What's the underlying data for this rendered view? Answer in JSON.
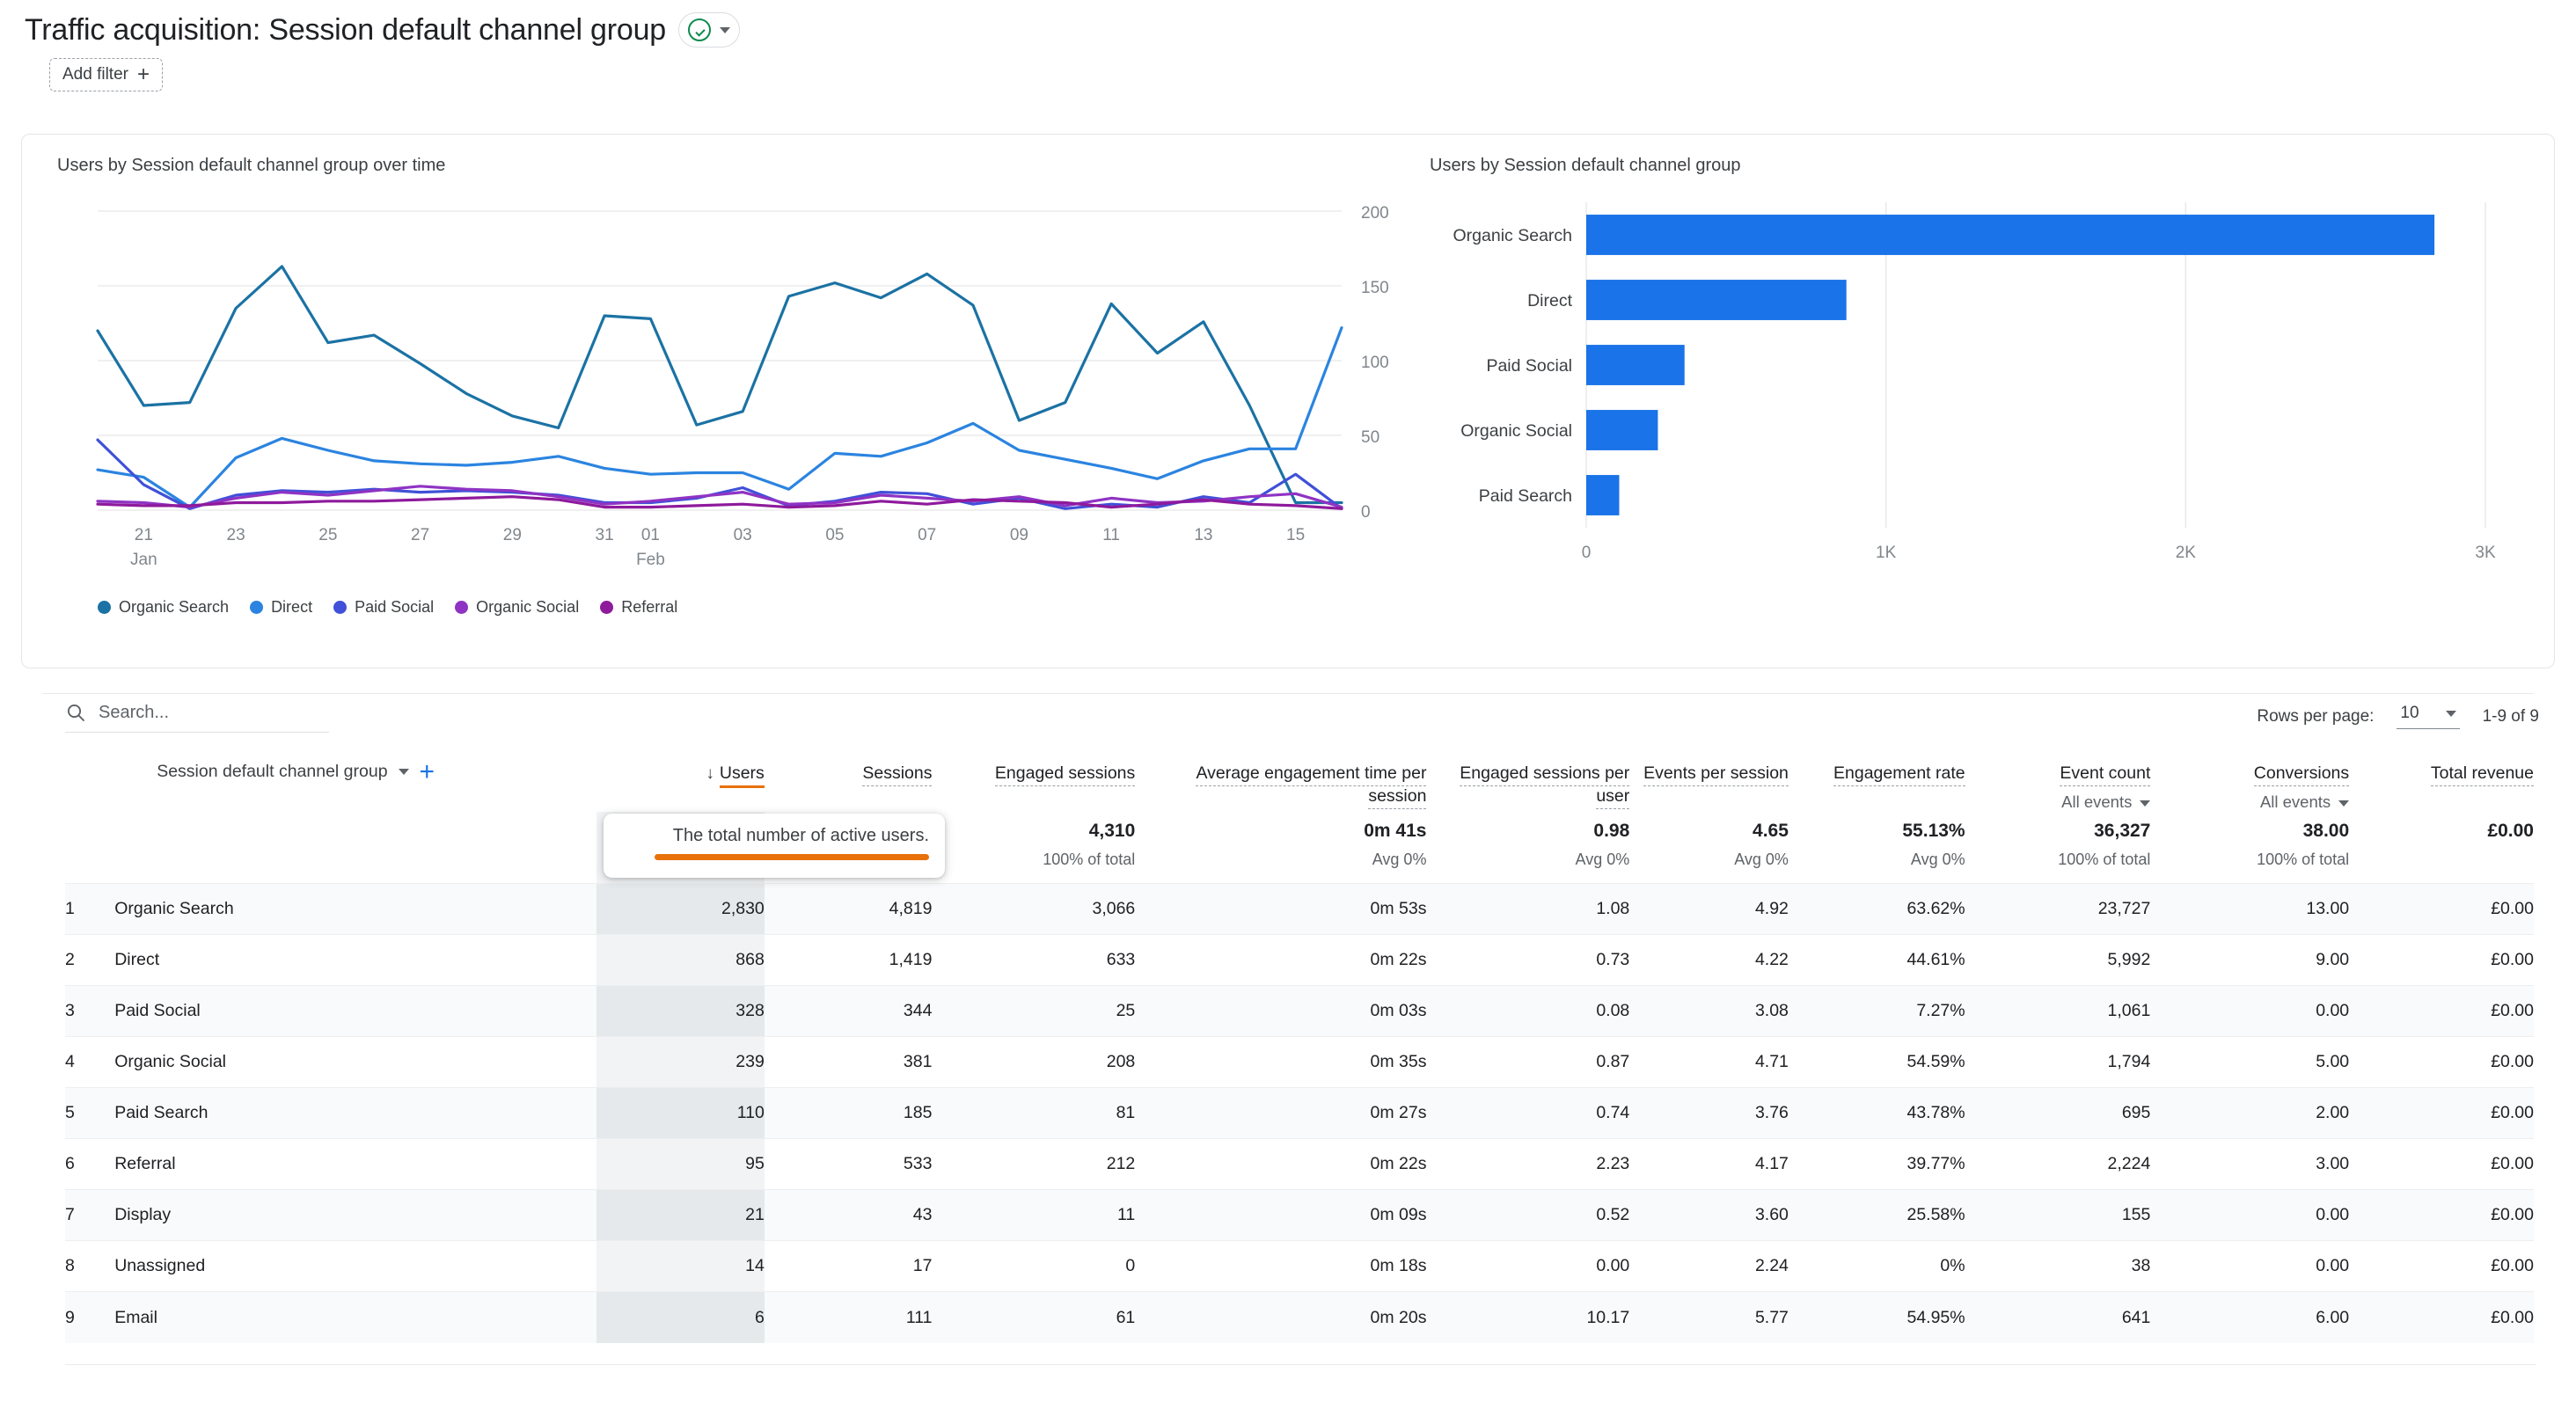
{
  "header": {
    "title": "Traffic acquisition: Session default channel group",
    "ai_icon": "check-circle-icon",
    "caret_icon": "chevron-down-icon",
    "add_filter_label": "Add filter",
    "add_filter_icon": "plus-icon"
  },
  "line_card": {
    "title": "Users by Session default channel group over time"
  },
  "bar_card": {
    "title": "Users by Session default channel group"
  },
  "toolbar": {
    "search_placeholder": "Search...",
    "search_icon": "search-icon",
    "rows_per_page_label": "Rows per page:",
    "rows_per_page_value": "10",
    "range_label": "1-9 of 9"
  },
  "tooltip": {
    "text": "The total number of active users.",
    "accent": "#e8710a"
  },
  "table": {
    "dimension_label": "Session default channel group",
    "add_dimension_icon": "plus-icon",
    "sort_icon": "arrow-down-icon",
    "columns": [
      {
        "label": "Users",
        "sorted": true
      },
      {
        "label": "Sessions"
      },
      {
        "label": "Engaged sessions"
      },
      {
        "label": "Average engagement time per session"
      },
      {
        "label": "Engaged sessions per user"
      },
      {
        "label": "Events per session"
      },
      {
        "label": "Engagement rate"
      },
      {
        "label": "Event count",
        "sub": "All events"
      },
      {
        "label": "Conversions",
        "sub": "All events"
      },
      {
        "label": "Total revenue"
      }
    ],
    "totals": [
      {
        "value": "",
        "sub": "100% of total"
      },
      {
        "value": "",
        "sub": "100% of total"
      },
      {
        "value": "4,310",
        "sub": "100% of total"
      },
      {
        "value": "0m 41s",
        "sub": "Avg 0%"
      },
      {
        "value": "0.98",
        "sub": "Avg 0%"
      },
      {
        "value": "4.65",
        "sub": "Avg 0%"
      },
      {
        "value": "55.13%",
        "sub": "Avg 0%"
      },
      {
        "value": "36,327",
        "sub": "100% of total"
      },
      {
        "value": "38.00",
        "sub": "100% of total"
      },
      {
        "value": "£0.00",
        "sub": ""
      }
    ],
    "rows": [
      {
        "index": "1",
        "name": "Organic Search",
        "cells": [
          "2,830",
          "4,819",
          "3,066",
          "0m 53s",
          "1.08",
          "4.92",
          "63.62%",
          "23,727",
          "13.00",
          "£0.00"
        ]
      },
      {
        "index": "2",
        "name": "Direct",
        "cells": [
          "868",
          "1,419",
          "633",
          "0m 22s",
          "0.73",
          "4.22",
          "44.61%",
          "5,992",
          "9.00",
          "£0.00"
        ]
      },
      {
        "index": "3",
        "name": "Paid Social",
        "cells": [
          "328",
          "344",
          "25",
          "0m 03s",
          "0.08",
          "3.08",
          "7.27%",
          "1,061",
          "0.00",
          "£0.00"
        ]
      },
      {
        "index": "4",
        "name": "Organic Social",
        "cells": [
          "239",
          "381",
          "208",
          "0m 35s",
          "0.87",
          "4.71",
          "54.59%",
          "1,794",
          "5.00",
          "£0.00"
        ]
      },
      {
        "index": "5",
        "name": "Paid Search",
        "cells": [
          "110",
          "185",
          "81",
          "0m 27s",
          "0.74",
          "3.76",
          "43.78%",
          "695",
          "2.00",
          "£0.00"
        ]
      },
      {
        "index": "6",
        "name": "Referral",
        "cells": [
          "95",
          "533",
          "212",
          "0m 22s",
          "2.23",
          "4.17",
          "39.77%",
          "2,224",
          "3.00",
          "£0.00"
        ]
      },
      {
        "index": "7",
        "name": "Display",
        "cells": [
          "21",
          "43",
          "11",
          "0m 09s",
          "0.52",
          "3.60",
          "25.58%",
          "155",
          "0.00",
          "£0.00"
        ]
      },
      {
        "index": "8",
        "name": "Unassigned",
        "cells": [
          "14",
          "17",
          "0",
          "0m 18s",
          "0.00",
          "2.24",
          "0%",
          "38",
          "0.00",
          "£0.00"
        ]
      },
      {
        "index": "9",
        "name": "Email",
        "cells": [
          "6",
          "111",
          "61",
          "0m 20s",
          "10.17",
          "5.77",
          "54.95%",
          "641",
          "6.00",
          "£0.00"
        ]
      }
    ]
  },
  "chart_data": [
    {
      "type": "line",
      "title": "Users by Session default channel group over time",
      "xlabel": "",
      "ylabel": "",
      "ylim": [
        0,
        200
      ],
      "yticks": [
        0,
        50,
        100,
        150,
        200
      ],
      "grid": true,
      "legend_position": "bottom",
      "x": [
        "20",
        "21",
        "22",
        "23",
        "24",
        "25",
        "26",
        "27",
        "28",
        "29",
        "30",
        "31",
        "01",
        "02",
        "03",
        "04",
        "05",
        "06",
        "07",
        "08",
        "09",
        "10",
        "11",
        "12",
        "13",
        "14",
        "15",
        "16"
      ],
      "xticks": [
        "21",
        "23",
        "25",
        "27",
        "29",
        "31",
        "01",
        "03",
        "05",
        "07",
        "09",
        "11",
        "13",
        "15"
      ],
      "xtick_sublabels": {
        "21": "Jan",
        "01": "Feb"
      },
      "series": [
        {
          "name": "Organic Search",
          "color": "#1b72a4",
          "values": [
            120,
            70,
            72,
            135,
            163,
            112,
            117,
            98,
            78,
            63,
            55,
            130,
            128,
            57,
            66,
            143,
            152,
            142,
            158,
            137,
            60,
            72,
            138,
            105,
            126,
            70,
            5,
            5
          ]
        },
        {
          "name": "Direct",
          "color": "#2b84e0",
          "values": [
            27,
            22,
            2,
            35,
            48,
            40,
            33,
            31,
            30,
            32,
            36,
            28,
            24,
            25,
            25,
            14,
            38,
            36,
            45,
            58,
            40,
            34,
            28,
            21,
            33,
            41,
            41,
            122
          ]
        },
        {
          "name": "Paid Social",
          "color": "#4050d8",
          "values": [
            47,
            17,
            1,
            10,
            13,
            12,
            14,
            12,
            13,
            12,
            10,
            5,
            5,
            8,
            15,
            3,
            6,
            12,
            11,
            4,
            8,
            1,
            4,
            2,
            9,
            5,
            24,
            1
          ]
        },
        {
          "name": "Organic Social",
          "color": "#8f33c4",
          "values": [
            6,
            5,
            2,
            8,
            12,
            10,
            13,
            16,
            14,
            13,
            9,
            4,
            6,
            9,
            12,
            4,
            5,
            10,
            8,
            6,
            9,
            3,
            8,
            5,
            6,
            9,
            11,
            2
          ]
        },
        {
          "name": "Referral",
          "color": "#8e1a9c",
          "values": [
            4,
            3,
            3,
            5,
            5,
            6,
            6,
            7,
            8,
            9,
            7,
            2,
            2,
            3,
            4,
            2,
            3,
            6,
            4,
            7,
            6,
            5,
            2,
            4,
            7,
            4,
            3,
            1
          ]
        }
      ]
    },
    {
      "type": "bar",
      "orientation": "horizontal",
      "title": "Users by Session default channel group",
      "categories": [
        "Organic Search",
        "Direct",
        "Paid Social",
        "Organic Social",
        "Paid Search"
      ],
      "values": [
        2830,
        868,
        328,
        239,
        110
      ],
      "xlim": [
        0,
        3000
      ],
      "xticks": [
        0,
        1000,
        2000,
        3000
      ],
      "xtick_labels": [
        "0",
        "1K",
        "2K",
        "3K"
      ],
      "bar_color": "#1a73e8",
      "grid": true
    }
  ]
}
